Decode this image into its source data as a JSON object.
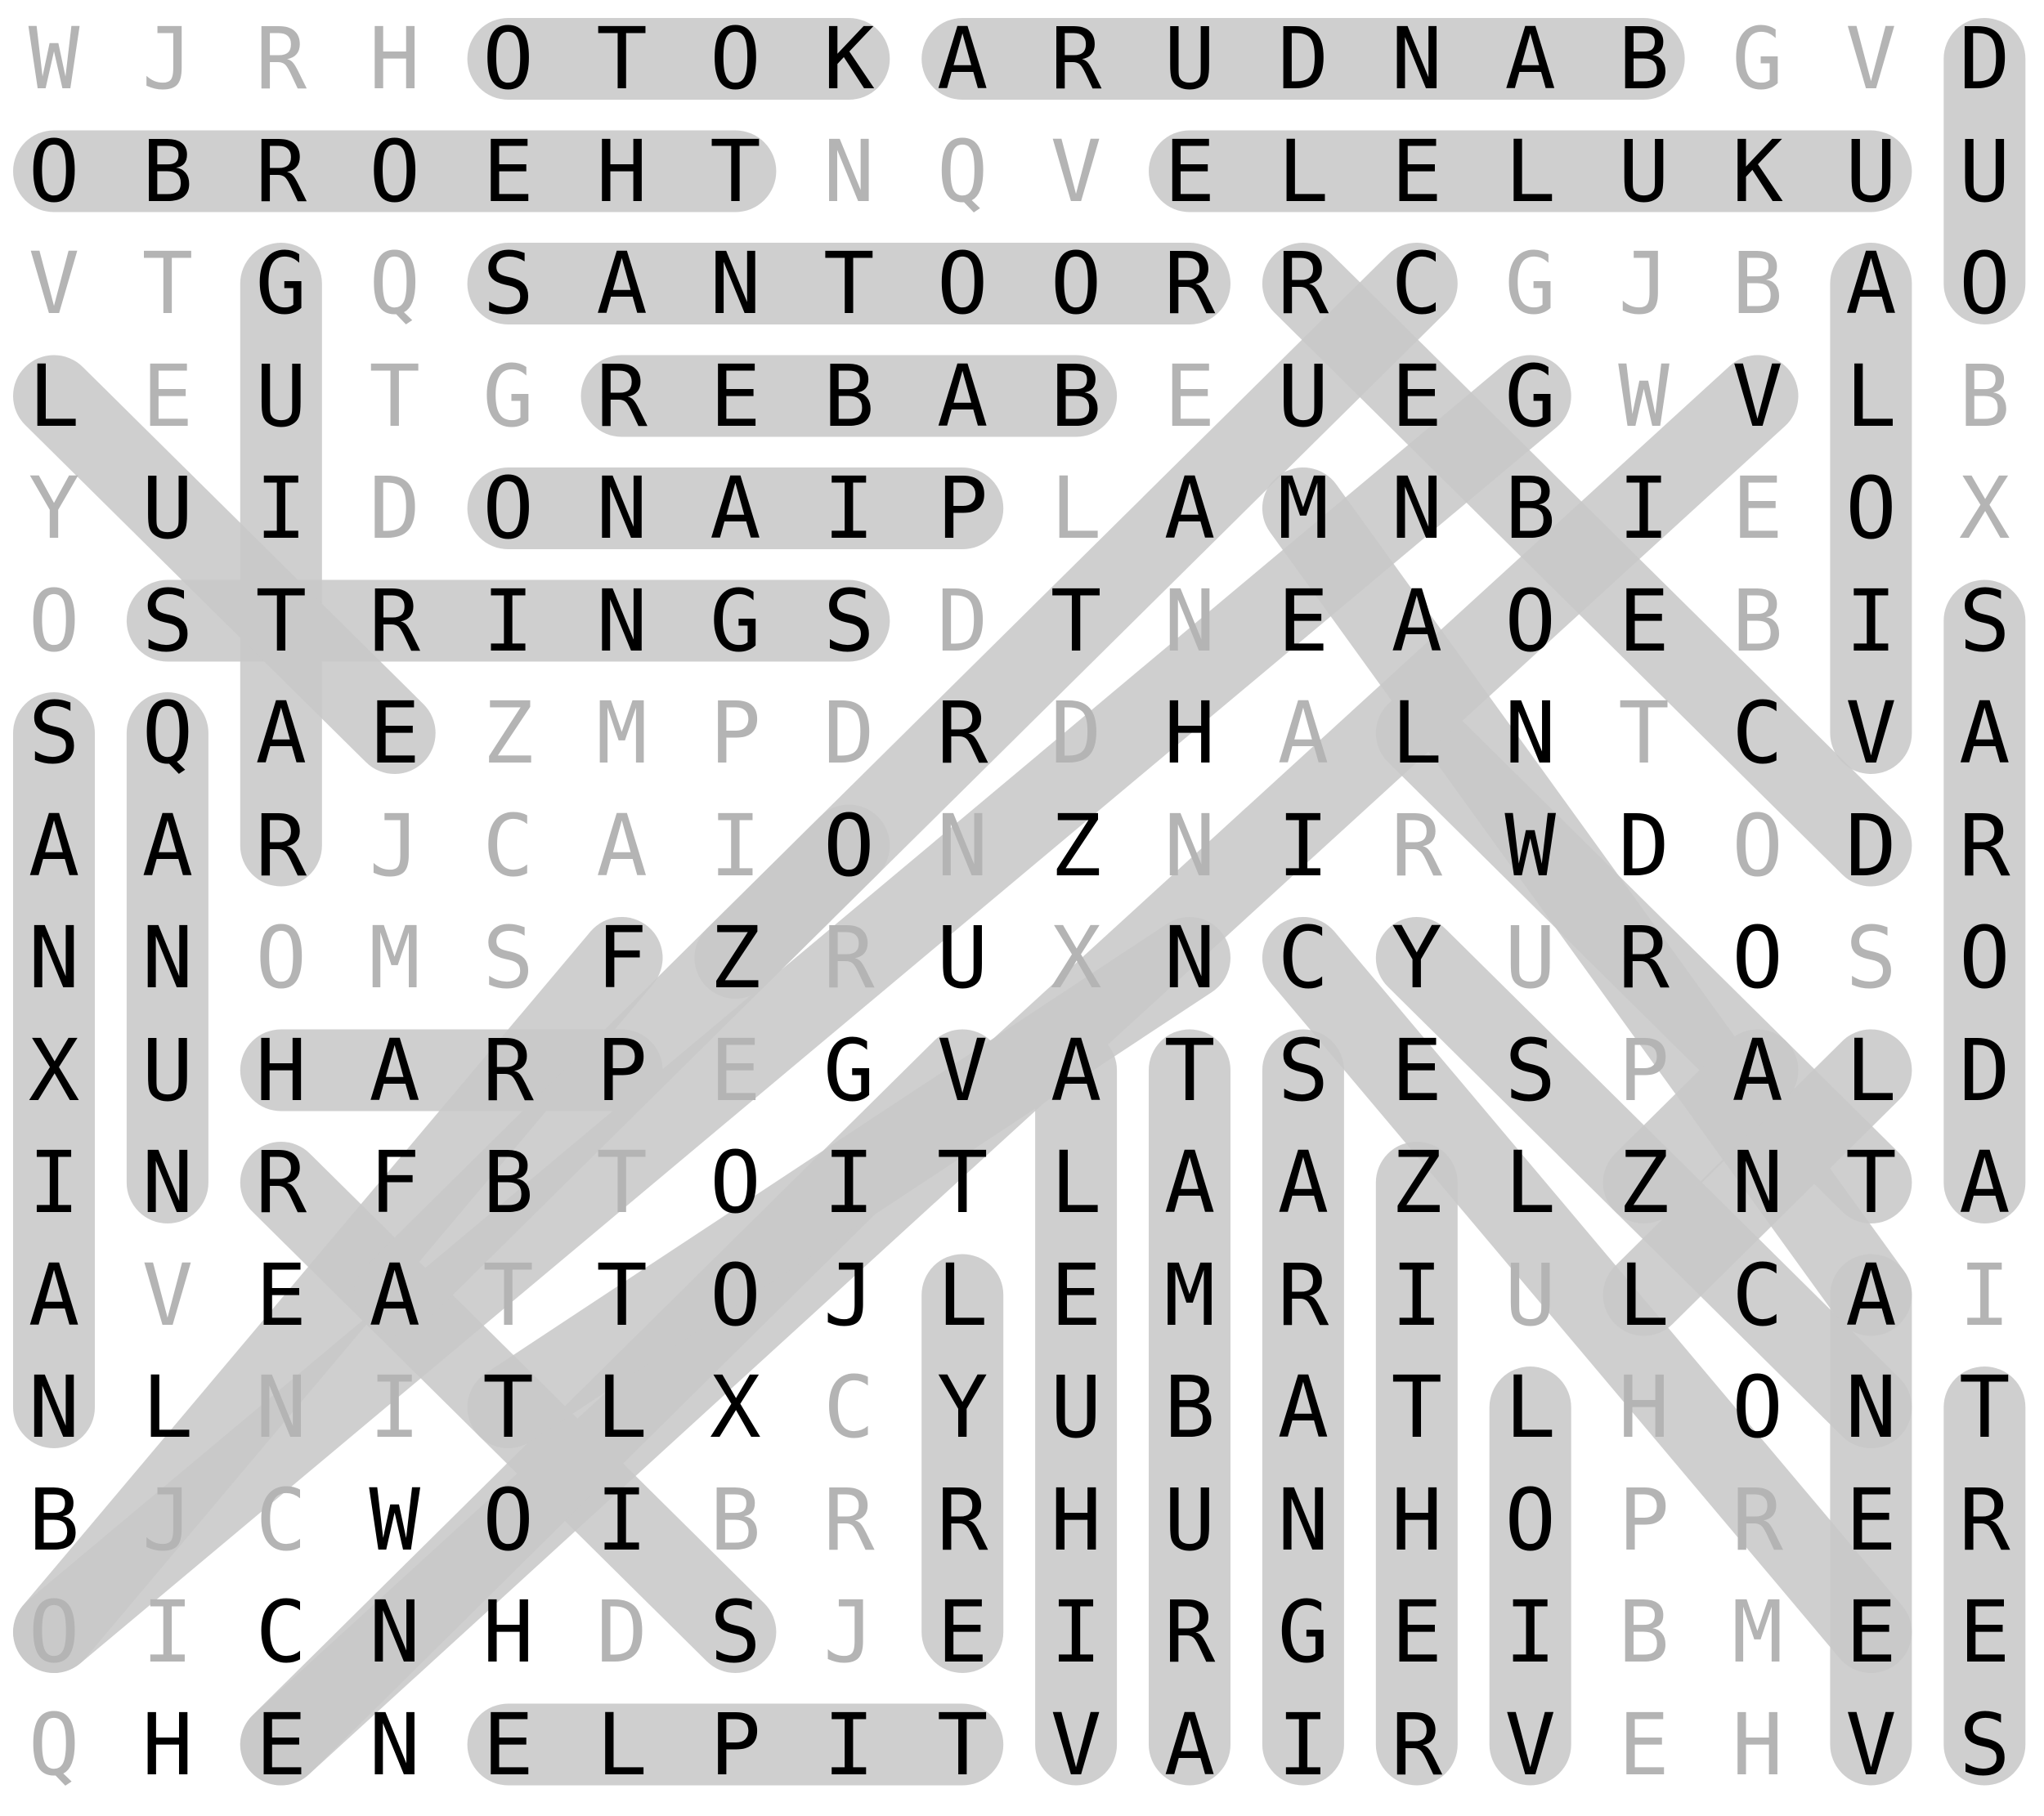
{
  "grid": [
    "WJRHOTOKARUDNABGVD",
    "OBROEHTNQVELELUKUU",
    "VTGQSANTOORRCGJBAO",
    "LEUTGREBABEUEGWVLB",
    "YUIDONAIPLAMNBIEOX",
    "OSTRINGSDTNEAOEBIS",
    "SQAEZMPDRDHALNTCVA",
    "AARJCAIONZNIRWDODR",
    "NNOMSFZRUXNCYUROSO",
    "XUHARPEGVATSESPALD",
    "INRFBTOITLAAZLZNTA",
    "AVEATTOJLEMRIULCAI",
    "NLNITLXCYUBATLHONT",
    "BJCWOIBRRHUNHOPRER",
    "OICNHDSJEIRGEIBMEE",
    "QHENELPITVAIRVEHVS"
  ],
  "colors": {
    "highlight": "#c9c9c9",
    "used_letter": "#000000",
    "unused_letter": "#b4b4b4"
  },
  "highlights": [
    {
      "start": [
        0,
        4
      ],
      "end": [
        0,
        7
      ]
    },
    {
      "start": [
        0,
        8
      ],
      "end": [
        0,
        14
      ]
    },
    {
      "start": [
        1,
        0
      ],
      "end": [
        1,
        6
      ]
    },
    {
      "start": [
        1,
        10
      ],
      "end": [
        1,
        16
      ]
    },
    {
      "start": [
        0,
        17
      ],
      "end": [
        2,
        17
      ]
    },
    {
      "start": [
        2,
        4
      ],
      "end": [
        2,
        10
      ]
    },
    {
      "start": [
        3,
        5
      ],
      "end": [
        3,
        9
      ]
    },
    {
      "start": [
        4,
        4
      ],
      "end": [
        4,
        8
      ]
    },
    {
      "start": [
        5,
        1
      ],
      "end": [
        5,
        7
      ]
    },
    {
      "start": [
        9,
        2
      ],
      "end": [
        9,
        5
      ]
    },
    {
      "start": [
        15,
        4
      ],
      "end": [
        15,
        8
      ]
    },
    {
      "start": [
        2,
        2
      ],
      "end": [
        7,
        2
      ]
    },
    {
      "start": [
        2,
        16
      ],
      "end": [
        6,
        16
      ]
    },
    {
      "start": [
        6,
        0
      ],
      "end": [
        12,
        0
      ]
    },
    {
      "start": [
        6,
        1
      ],
      "end": [
        10,
        1
      ]
    },
    {
      "start": [
        5,
        17
      ],
      "end": [
        10,
        17
      ]
    },
    {
      "start": [
        11,
        8
      ],
      "end": [
        14,
        8
      ]
    },
    {
      "start": [
        9,
        9
      ],
      "end": [
        15,
        9
      ]
    },
    {
      "start": [
        9,
        10
      ],
      "end": [
        15,
        10
      ]
    },
    {
      "start": [
        9,
        11
      ],
      "end": [
        15,
        11
      ]
    },
    {
      "start": [
        10,
        12
      ],
      "end": [
        15,
        12
      ]
    },
    {
      "start": [
        12,
        13
      ],
      "end": [
        15,
        13
      ]
    },
    {
      "start": [
        11,
        16
      ],
      "end": [
        15,
        16
      ]
    },
    {
      "start": [
        12,
        17
      ],
      "end": [
        15,
        17
      ]
    },
    {
      "start": [
        3,
        0
      ],
      "end": [
        6,
        3
      ]
    },
    {
      "start": [
        10,
        2
      ],
      "end": [
        14,
        6
      ]
    },
    {
      "start": [
        2,
        11
      ],
      "end": [
        7,
        16
      ]
    },
    {
      "start": [
        4,
        11
      ],
      "end": [
        11,
        16
      ]
    },
    {
      "start": [
        6,
        12
      ],
      "end": [
        10,
        16
      ]
    },
    {
      "start": [
        8,
        11
      ],
      "end": [
        14,
        16
      ]
    },
    {
      "start": [
        8,
        12
      ],
      "end": [
        12,
        16
      ]
    },
    {
      "start": [
        2,
        12
      ],
      "end": [
        8,
        6
      ]
    },
    {
      "start": [
        3,
        13
      ],
      "end": [
        14,
        0
      ]
    },
    {
      "start": [
        3,
        15
      ],
      "end": [
        15,
        2
      ]
    },
    {
      "start": [
        8,
        5
      ],
      "end": [
        14,
        0
      ]
    },
    {
      "start": [
        9,
        8
      ],
      "end": [
        15,
        2
      ]
    },
    {
      "start": [
        8,
        10
      ],
      "end": [
        12,
        4
      ]
    },
    {
      "start": [
        7,
        7
      ],
      "end": [
        11,
        3
      ]
    },
    {
      "start": [
        10,
        14
      ],
      "end": [
        9,
        15
      ]
    },
    {
      "start": [
        9,
        16
      ],
      "end": [
        11,
        14
      ]
    }
  ]
}
